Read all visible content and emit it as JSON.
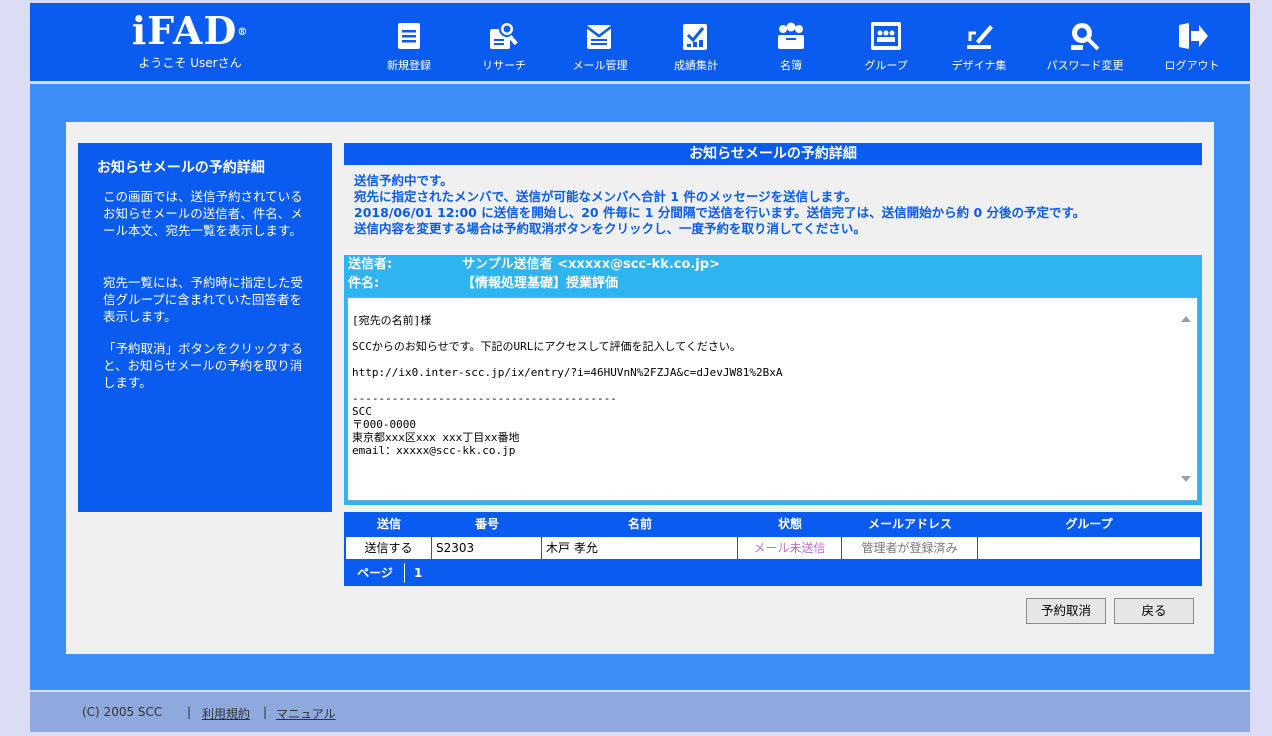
{
  "header": {
    "brand": "iFAD",
    "brand_mark": "®",
    "welcome": "ようこそ Userさん",
    "nav": [
      {
        "label": "新規登録",
        "icon": "document-icon"
      },
      {
        "label": "リサーチ",
        "icon": "research-icon"
      },
      {
        "label": "メール管理",
        "icon": "mail-icon"
      },
      {
        "label": "成績集計",
        "icon": "grades-icon"
      },
      {
        "label": "名簿",
        "icon": "roster-icon"
      },
      {
        "label": "グループ",
        "icon": "group-icon"
      },
      {
        "label": "デザイナ集",
        "icon": "designer-icon"
      },
      {
        "label": "パスワード変更",
        "icon": "password-icon"
      },
      {
        "label": "ログアウト",
        "icon": "logout-icon"
      }
    ]
  },
  "sidebar": {
    "title": "お知らせメールの予約詳細",
    "p1": "この画面では、送信予約されているお知らせメールの送信者、件名、メール本文、宛先一覧を表示します。",
    "p2": "宛先一覧には、予約時に指定した受信グループに含まれていた回答者を表示します。",
    "p3": "「予約取消」ボタンをクリックすると、お知らせメールの予約を取り消します。"
  },
  "main": {
    "title": "お知らせメールの予約詳細",
    "notice": [
      "送信予約中です。",
      "宛先に指定されたメンバで、送信が可能なメンバへ合計 1 件のメッセージを送信します。",
      "2018/06/01 12:00 に送信を開始し、20 件毎に 1 分間隔で送信を行います。送信完了は、送信開始から約 0 分後の予定です。",
      "送信内容を変更する場合は予約取消ボタンをクリックし、一度予約を取り消してください。"
    ],
    "sender_label": "送信者:",
    "sender_value": "サンプル送信者 <xxxxx@scc-kk.co.jp>",
    "subject_label": "件名:",
    "subject_value": "【情報処理基礎】授業評価",
    "body": "[宛先の名前]様\n\nSCCからのお知らせです。下記のURLにアクセスして評価を記入してください。\n\nhttp://ix0.inter-scc.jp/ix/entry/?i=46HUVnN%2FZJA&c=dJevJW81%2BxA\n\n----------------------------------------\nSCC\n〒000-0000\n東京都xxx区xxx xxx丁目xx番地\nemail：xxxxx@scc-kk.co.jp"
  },
  "table": {
    "headers": [
      "送信",
      "番号",
      "名前",
      "状態",
      "メールアドレス",
      "グループ"
    ],
    "rows": [
      [
        "送信する",
        "S2303",
        "木戸 孝允",
        "メール未送信",
        "管理者が登録済み",
        ""
      ]
    ],
    "status_color": "#c070c0",
    "pager_label": "ページ",
    "pager_current": "1"
  },
  "buttons": {
    "cancel": "予約取消",
    "back": "戻る"
  },
  "footer": {
    "copyright": "(C) 2005 SCC",
    "sep1": "|",
    "terms": "利用規約",
    "sep2": "|",
    "manual": "マニュアル"
  },
  "colors": {
    "header": "#0a5cf0",
    "band": "#3d8ef7",
    "mail_box": "#2eb4f0",
    "footer": "#8fa9df"
  }
}
